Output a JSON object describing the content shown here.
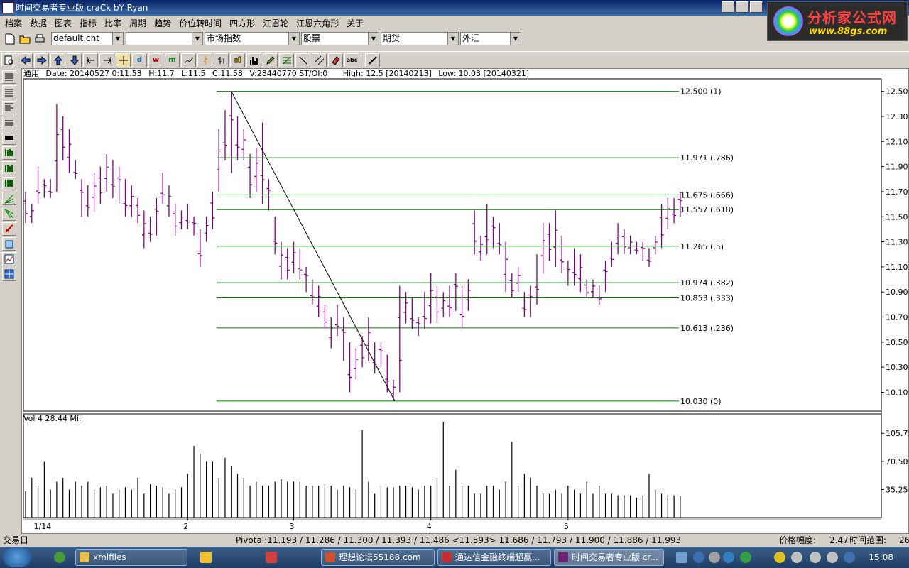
{
  "window": {
    "title": "时间交易者专业版 craCk bY Ryan"
  },
  "menu": [
    "档案",
    "数据",
    "图表",
    "指标",
    "比率",
    "周期",
    "趋势",
    "价位转时间",
    "四方形",
    "江恩轮",
    "江恩六角形",
    "关于"
  ],
  "logo": {
    "brand": "分析家公式网",
    "url": "www.88gs.com"
  },
  "toolbar1": {
    "chart_file": "default.cht",
    "combo2": "",
    "market": "市场指数",
    "stocks": "股票",
    "futures": "期货",
    "forex": "外汇"
  },
  "toolbar2_icons": [
    "print-preview-icon",
    "arrow-left-icon",
    "arrow-right-icon",
    "arrow-up-icon",
    "arrow-down-icon",
    "scroll-start-icon",
    "scroll-end-icon",
    "crosshair-icon",
    "daily-icon",
    "weekly-icon",
    "monthly-icon",
    "line-icon",
    "tick-icon",
    "ohlc-icon",
    "candle-icon",
    "volume-icon",
    "pencil-icon",
    "fib-icon",
    "trendline-icon",
    "parallel-icon",
    "erase-icon",
    "abc-icon",
    "brush-icon"
  ],
  "toolbar2_labels": {
    "daily": "d",
    "weekly": "w",
    "monthly": "m"
  },
  "sidebar_icons": [
    "layout-1-icon",
    "layout-2-icon",
    "layout-3-icon",
    "layout-4-icon",
    "layout-5-icon",
    "bars-1-icon",
    "bars-2-icon",
    "bars-3-icon",
    "gann-fan-icon",
    "gann-fan-2-icon",
    "pen-icon",
    "square-icon",
    "chart-icon",
    "grid-icon"
  ],
  "info": {
    "label": "通用",
    "date": "Date: 20140527 0:11.53",
    "high": "H:11.7",
    "low": "L:11.5",
    "close": "C:11.58",
    "volume": "V:28440770 ST/OI:0",
    "period_high": "High: 12.5 [20140213]",
    "period_low": "Low: 10.03 [20140321]"
  },
  "volume_label": "Vol 4  28.44 Mil",
  "status": {
    "left": "交易日",
    "pivot": "Pivotal:11.193 / 11.286 / 11.300 / 11.393 / 11.486 <11.593> 11.686 / 11.793 / 11.900 / 11.886 / 11.993",
    "range_label": "价格幅度:",
    "range_value": "2.47",
    "time_label": "时间范围:",
    "time_value": "26"
  },
  "taskbar": {
    "tasks": [
      "xmlfiles",
      "理想论坛55188.com",
      "通达信金融终端超赢...",
      "时间交易者专业版 cr..."
    ],
    "clock": "15:08"
  },
  "colors": {
    "bars": "#800080",
    "fib": "#008000",
    "trend": "#000000"
  },
  "chart_data": {
    "type": "ohlc",
    "y_range": [
      9.95,
      12.6
    ],
    "y_ticks": [
      "12.50",
      "12.30",
      "12.10",
      "11.90",
      "11.70",
      "11.50",
      "11.30",
      "11.10",
      "10.90",
      "10.70",
      "10.50",
      "10.30",
      "10.10"
    ],
    "x_ticks": [
      "1/14",
      "2",
      "3",
      "4",
      "5"
    ],
    "fib_levels": [
      {
        "value": 12.5,
        "label": "12.500  (1)"
      },
      {
        "value": 11.971,
        "label": "11.971  (.786)"
      },
      {
        "value": 11.675,
        "label": "11.675  (.666)"
      },
      {
        "value": 11.557,
        "label": "11.557  (.618)"
      },
      {
        "value": 11.265,
        "label": "11.265  (.5)"
      },
      {
        "value": 10.974,
        "label": "10.974  (.382)"
      },
      {
        "value": 10.853,
        "label": "10.853  (.333)"
      },
      {
        "value": 10.613,
        "label": "10.613  (.236)"
      },
      {
        "value": 10.03,
        "label": "10.030  (0)"
      }
    ],
    "bars": [
      [
        11.7,
        11.45
      ],
      [
        11.6,
        11.45
      ],
      [
        11.9,
        11.6
      ],
      [
        11.8,
        11.65
      ],
      [
        11.8,
        11.65
      ],
      [
        12.4,
        11.7
      ],
      [
        12.3,
        11.95
      ],
      [
        12.2,
        11.85
      ],
      [
        11.95,
        11.8
      ],
      [
        11.8,
        11.5
      ],
      [
        11.75,
        11.5
      ],
      [
        11.85,
        11.55
      ],
      [
        11.9,
        11.6
      ],
      [
        12.0,
        11.7
      ],
      [
        11.95,
        11.65
      ],
      [
        11.9,
        11.6
      ],
      [
        11.8,
        11.5
      ],
      [
        11.75,
        11.5
      ],
      [
        11.65,
        11.45
      ],
      [
        11.55,
        11.25
      ],
      [
        11.5,
        11.3
      ],
      [
        11.65,
        11.35
      ],
      [
        11.85,
        11.6
      ],
      [
        11.75,
        11.5
      ],
      [
        11.6,
        11.35
      ],
      [
        11.55,
        11.4
      ],
      [
        11.6,
        11.4
      ],
      [
        11.5,
        11.35
      ],
      [
        11.4,
        11.1
      ],
      [
        11.5,
        11.3
      ],
      [
        11.7,
        11.4
      ],
      [
        12.2,
        11.7
      ],
      [
        12.35,
        11.95
      ],
      [
        12.5,
        11.85
      ],
      [
        12.3,
        11.95
      ],
      [
        12.2,
        11.95
      ],
      [
        12.0,
        11.65
      ],
      [
        12.05,
        11.7
      ],
      [
        12.25,
        11.6
      ],
      [
        11.8,
        11.55
      ],
      [
        11.5,
        11.2
      ],
      [
        11.3,
        11.0
      ],
      [
        11.25,
        11.0
      ],
      [
        11.3,
        11.05
      ],
      [
        11.25,
        11.0
      ],
      [
        11.1,
        10.9
      ],
      [
        11.0,
        10.8
      ],
      [
        10.95,
        10.7
      ],
      [
        10.8,
        10.6
      ],
      [
        10.7,
        10.45
      ],
      [
        10.8,
        10.55
      ],
      [
        10.7,
        10.35
      ],
      [
        10.5,
        10.1
      ],
      [
        10.45,
        10.2
      ],
      [
        10.55,
        10.3
      ],
      [
        10.7,
        10.35
      ],
      [
        10.5,
        10.25
      ],
      [
        10.5,
        10.3
      ],
      [
        10.4,
        10.1
      ],
      [
        10.2,
        10.03
      ],
      [
        10.95,
        10.1
      ],
      [
        10.9,
        10.65
      ],
      [
        10.85,
        10.6
      ],
      [
        10.7,
        10.55
      ],
      [
        10.9,
        10.6
      ],
      [
        11.05,
        10.65
      ],
      [
        10.95,
        10.65
      ],
      [
        10.9,
        10.7
      ],
      [
        10.95,
        10.7
      ],
      [
        11.05,
        10.75
      ],
      [
        10.95,
        10.6
      ],
      [
        11.0,
        10.75
      ],
      [
        11.55,
        11.2
      ],
      [
        11.35,
        11.15
      ],
      [
        11.6,
        11.2
      ],
      [
        11.5,
        11.25
      ],
      [
        11.45,
        11.2
      ],
      [
        11.3,
        10.9
      ],
      [
        11.05,
        10.85
      ],
      [
        11.1,
        10.9
      ],
      [
        10.9,
        10.7
      ],
      [
        10.95,
        10.7
      ],
      [
        11.2,
        10.8
      ],
      [
        11.45,
        11.05
      ],
      [
        11.45,
        11.15
      ],
      [
        11.55,
        11.1
      ],
      [
        11.35,
        11.05
      ],
      [
        11.15,
        10.95
      ],
      [
        11.25,
        10.95
      ],
      [
        11.2,
        10.9
      ],
      [
        11.0,
        10.85
      ],
      [
        11.0,
        10.85
      ],
      [
        10.95,
        10.8
      ],
      [
        11.15,
        10.9
      ],
      [
        11.3,
        11.1
      ],
      [
        11.45,
        11.2
      ],
      [
        11.4,
        11.2
      ],
      [
        11.35,
        11.2
      ],
      [
        11.3,
        11.2
      ],
      [
        11.3,
        11.15
      ],
      [
        11.25,
        11.1
      ],
      [
        11.35,
        11.2
      ],
      [
        11.6,
        11.25
      ],
      [
        11.65,
        11.4
      ],
      [
        11.65,
        11.45
      ],
      [
        11.7,
        11.5
      ]
    ],
    "volume_y_range": [
      0,
      130
    ],
    "volume_ticks": [
      "105.75",
      "70.50",
      "35.25"
    ],
    "volume": [
      33,
      50,
      40,
      70,
      35,
      45,
      50,
      35,
      45,
      40,
      45,
      35,
      38,
      40,
      30,
      35,
      38,
      35,
      50,
      30,
      42,
      40,
      38,
      30,
      35,
      38,
      55,
      90,
      80,
      70,
      70,
      50,
      75,
      65,
      55,
      50,
      40,
      45,
      40,
      40,
      45,
      48,
      45,
      45,
      45,
      40,
      40,
      40,
      42,
      40,
      35,
      40,
      38,
      35,
      110,
      45,
      30,
      40,
      38,
      38,
      40,
      40,
      38,
      35,
      40,
      40,
      50,
      120,
      40,
      60,
      40,
      40,
      30,
      30,
      40,
      40,
      35,
      45,
      95,
      40,
      55,
      50,
      40,
      30,
      30,
      35,
      30,
      40,
      35,
      30,
      45,
      30,
      40,
      30,
      30,
      28,
      28,
      28,
      25,
      28,
      55,
      35,
      30,
      28,
      28,
      27
    ]
  }
}
